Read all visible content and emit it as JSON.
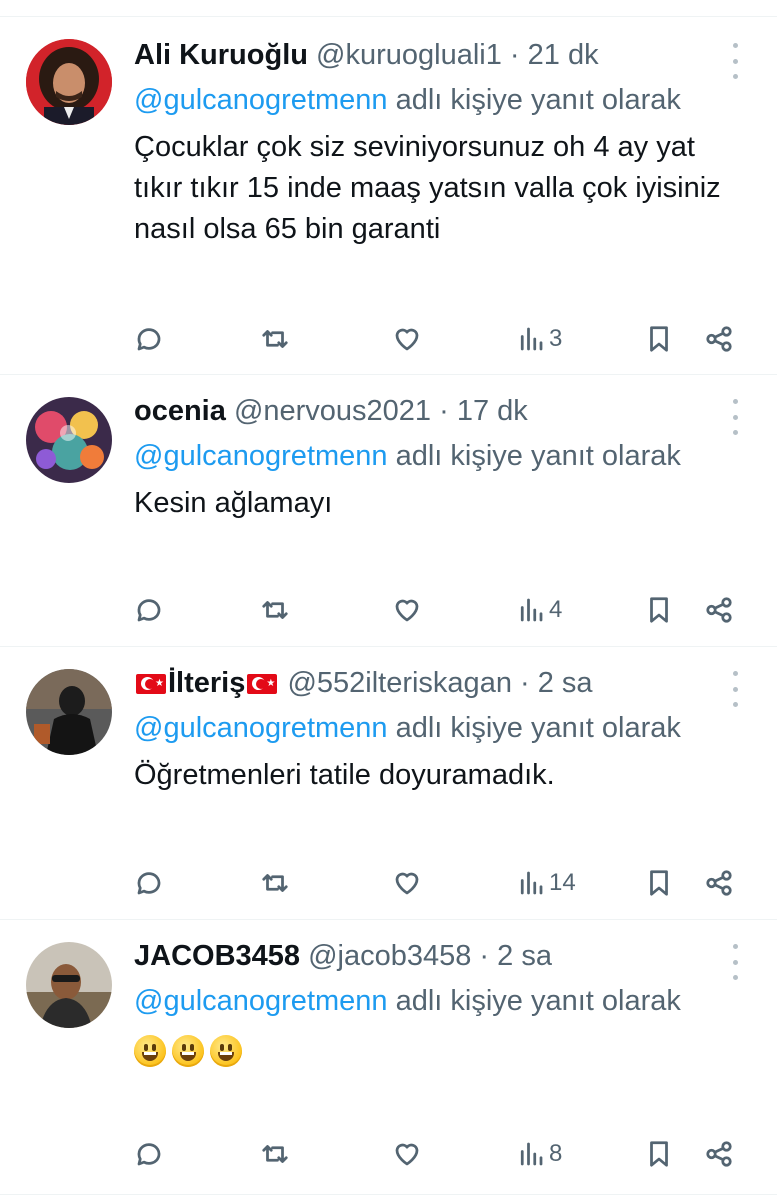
{
  "tweets": [
    {
      "name": "Ali Kuruoğlu",
      "handle": "@kuruogluali1",
      "dot": " · ",
      "time": "21 dk",
      "reply_mention": "@gulcanogretmenn",
      "reply_rest": " adlı kişiye yanıt olarak",
      "text": "Çocuklar çok siz seviniyorsunuz oh 4 ay yat tıkır tıkır 15 inde maaş yatsın valla çok iyisiniz nasıl olsa 65 bin garanti",
      "views": "3",
      "avatar_icon": "avatar-curly-hair-man"
    },
    {
      "name": "ocenia",
      "handle": "@nervous2021",
      "dot": " · ",
      "time": "17 dk",
      "reply_mention": "@gulcanogretmenn",
      "reply_rest": " adlı kişiye yanıt olarak",
      "text": "Kesin ağlamayı",
      "views": "4",
      "avatar_icon": "avatar-colorful-painting"
    },
    {
      "name": "İlteriş",
      "handle": "@552ilteriskagan",
      "dot": " · ",
      "time": "2 sa",
      "reply_mention": "@gulcanogretmenn",
      "reply_rest": " adlı kişiye yanıt olarak",
      "text": "Öğretmenleri tatile doyuramadık.",
      "views": "14",
      "avatar_icon": "avatar-dark-figure"
    },
    {
      "name": "JACOB3458",
      "handle": "@jacob3458",
      "dot": " · ",
      "time": "2 sa",
      "reply_mention": "@gulcanogretmenn",
      "reply_rest": " adlı kişiye yanıt olarak",
      "text": "",
      "emoji_count": 3,
      "views": "8",
      "avatar_icon": "avatar-man-sunglasses"
    }
  ],
  "colors": {
    "link": "#1d9bf0",
    "secondary": "#536471",
    "divider": "#eff3f4",
    "text": "#0f1419"
  },
  "icons": [
    "reply-icon",
    "retweet-icon",
    "like-icon",
    "views-icon",
    "bookmark-icon",
    "share-icon",
    "more-icon"
  ]
}
